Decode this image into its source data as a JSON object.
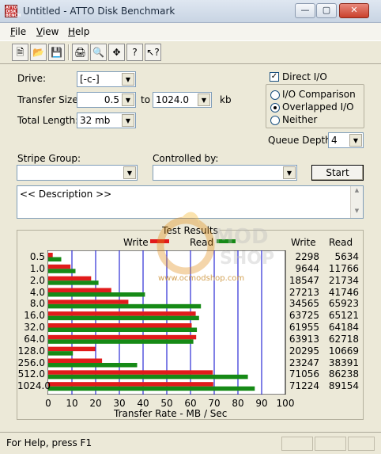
{
  "window": {
    "title": "Untitled - ATTO Disk Benchmark",
    "icon_text": "ATTO DISK BENCH",
    "buttons": [
      "minimize",
      "maximize",
      "close"
    ]
  },
  "menu": [
    "File",
    "View",
    "Help"
  ],
  "menu_underline": [
    "F",
    "V",
    "H"
  ],
  "toolbar": [
    "new-icon",
    "open-icon",
    "save-icon",
    "print-icon",
    "print-preview-icon",
    "move-icon",
    "help-icon",
    "context-help-icon"
  ],
  "form": {
    "drive_label": "Drive:",
    "drive_value": "[-c-]",
    "transfer_size_label": "Transfer Size:",
    "transfer_from": "0.5",
    "transfer_to_label": "to",
    "transfer_to": "1024.0",
    "transfer_unit": "kb",
    "total_length_label": "Total Length:",
    "total_length": "32 mb",
    "direct_io_label": "Direct I/O",
    "direct_io_checked": true,
    "io_comparison_label": "I/O Comparison",
    "overlapped_io_label": "Overlapped I/O",
    "neither_label": "Neither",
    "selected_mode": "Overlapped I/O",
    "queue_depth_label": "Queue Depth:",
    "queue_depth": "4",
    "stripe_group_label": "Stripe Group:",
    "controlled_by_label": "Controlled by:",
    "start_label": "Start",
    "description": "<< Description >>"
  },
  "results": {
    "title": "Test Results",
    "write_legend": "Write",
    "read_legend": "Read",
    "write_col": "Write",
    "read_col": "Read",
    "write_color": "#e11b1b",
    "read_color": "#168a16",
    "xlabel": "Transfer Rate - MB / Sec"
  },
  "chart_data": {
    "type": "bar",
    "orientation": "horizontal",
    "title": "Test Results",
    "xlabel": "Transfer Rate - MB / Sec",
    "xlim": [
      0,
      100
    ],
    "x_ticks": [
      "0",
      "10",
      "20",
      "30",
      "40",
      "50",
      "60",
      "70",
      "80",
      "90",
      "100"
    ],
    "categories": [
      "0.5",
      "1.0",
      "2.0",
      "4.0",
      "8.0",
      "16.0",
      "32.0",
      "64.0",
      "128.0",
      "256.0",
      "512.0",
      "1024.0"
    ],
    "series": [
      {
        "name": "Write",
        "values": [
          1.9,
          9.4,
          18.1,
          26.6,
          33.8,
          62.2,
          60.5,
          62.4,
          19.8,
          22.7,
          69.4,
          69.6
        ]
      },
      {
        "name": "Read",
        "values": [
          5.5,
          11.5,
          21.2,
          40.8,
          64.4,
          63.6,
          62.7,
          61.2,
          10.4,
          37.5,
          84.2,
          87.1
        ]
      }
    ],
    "write_values": [
      "2298",
      "9644",
      "18547",
      "27213",
      "34565",
      "63725",
      "61955",
      "63913",
      "20295",
      "23247",
      "71056",
      "71224"
    ],
    "read_values": [
      "5634",
      "11766",
      "21734",
      "41746",
      "65923",
      "65121",
      "64184",
      "62718",
      "10669",
      "38391",
      "86238",
      "89154"
    ],
    "grid": true,
    "legend": "top"
  },
  "watermark": {
    "brand": "OC MOD SHOP",
    "site": "www.ocmodshop.com"
  },
  "status": {
    "text": "For Help, press F1"
  }
}
